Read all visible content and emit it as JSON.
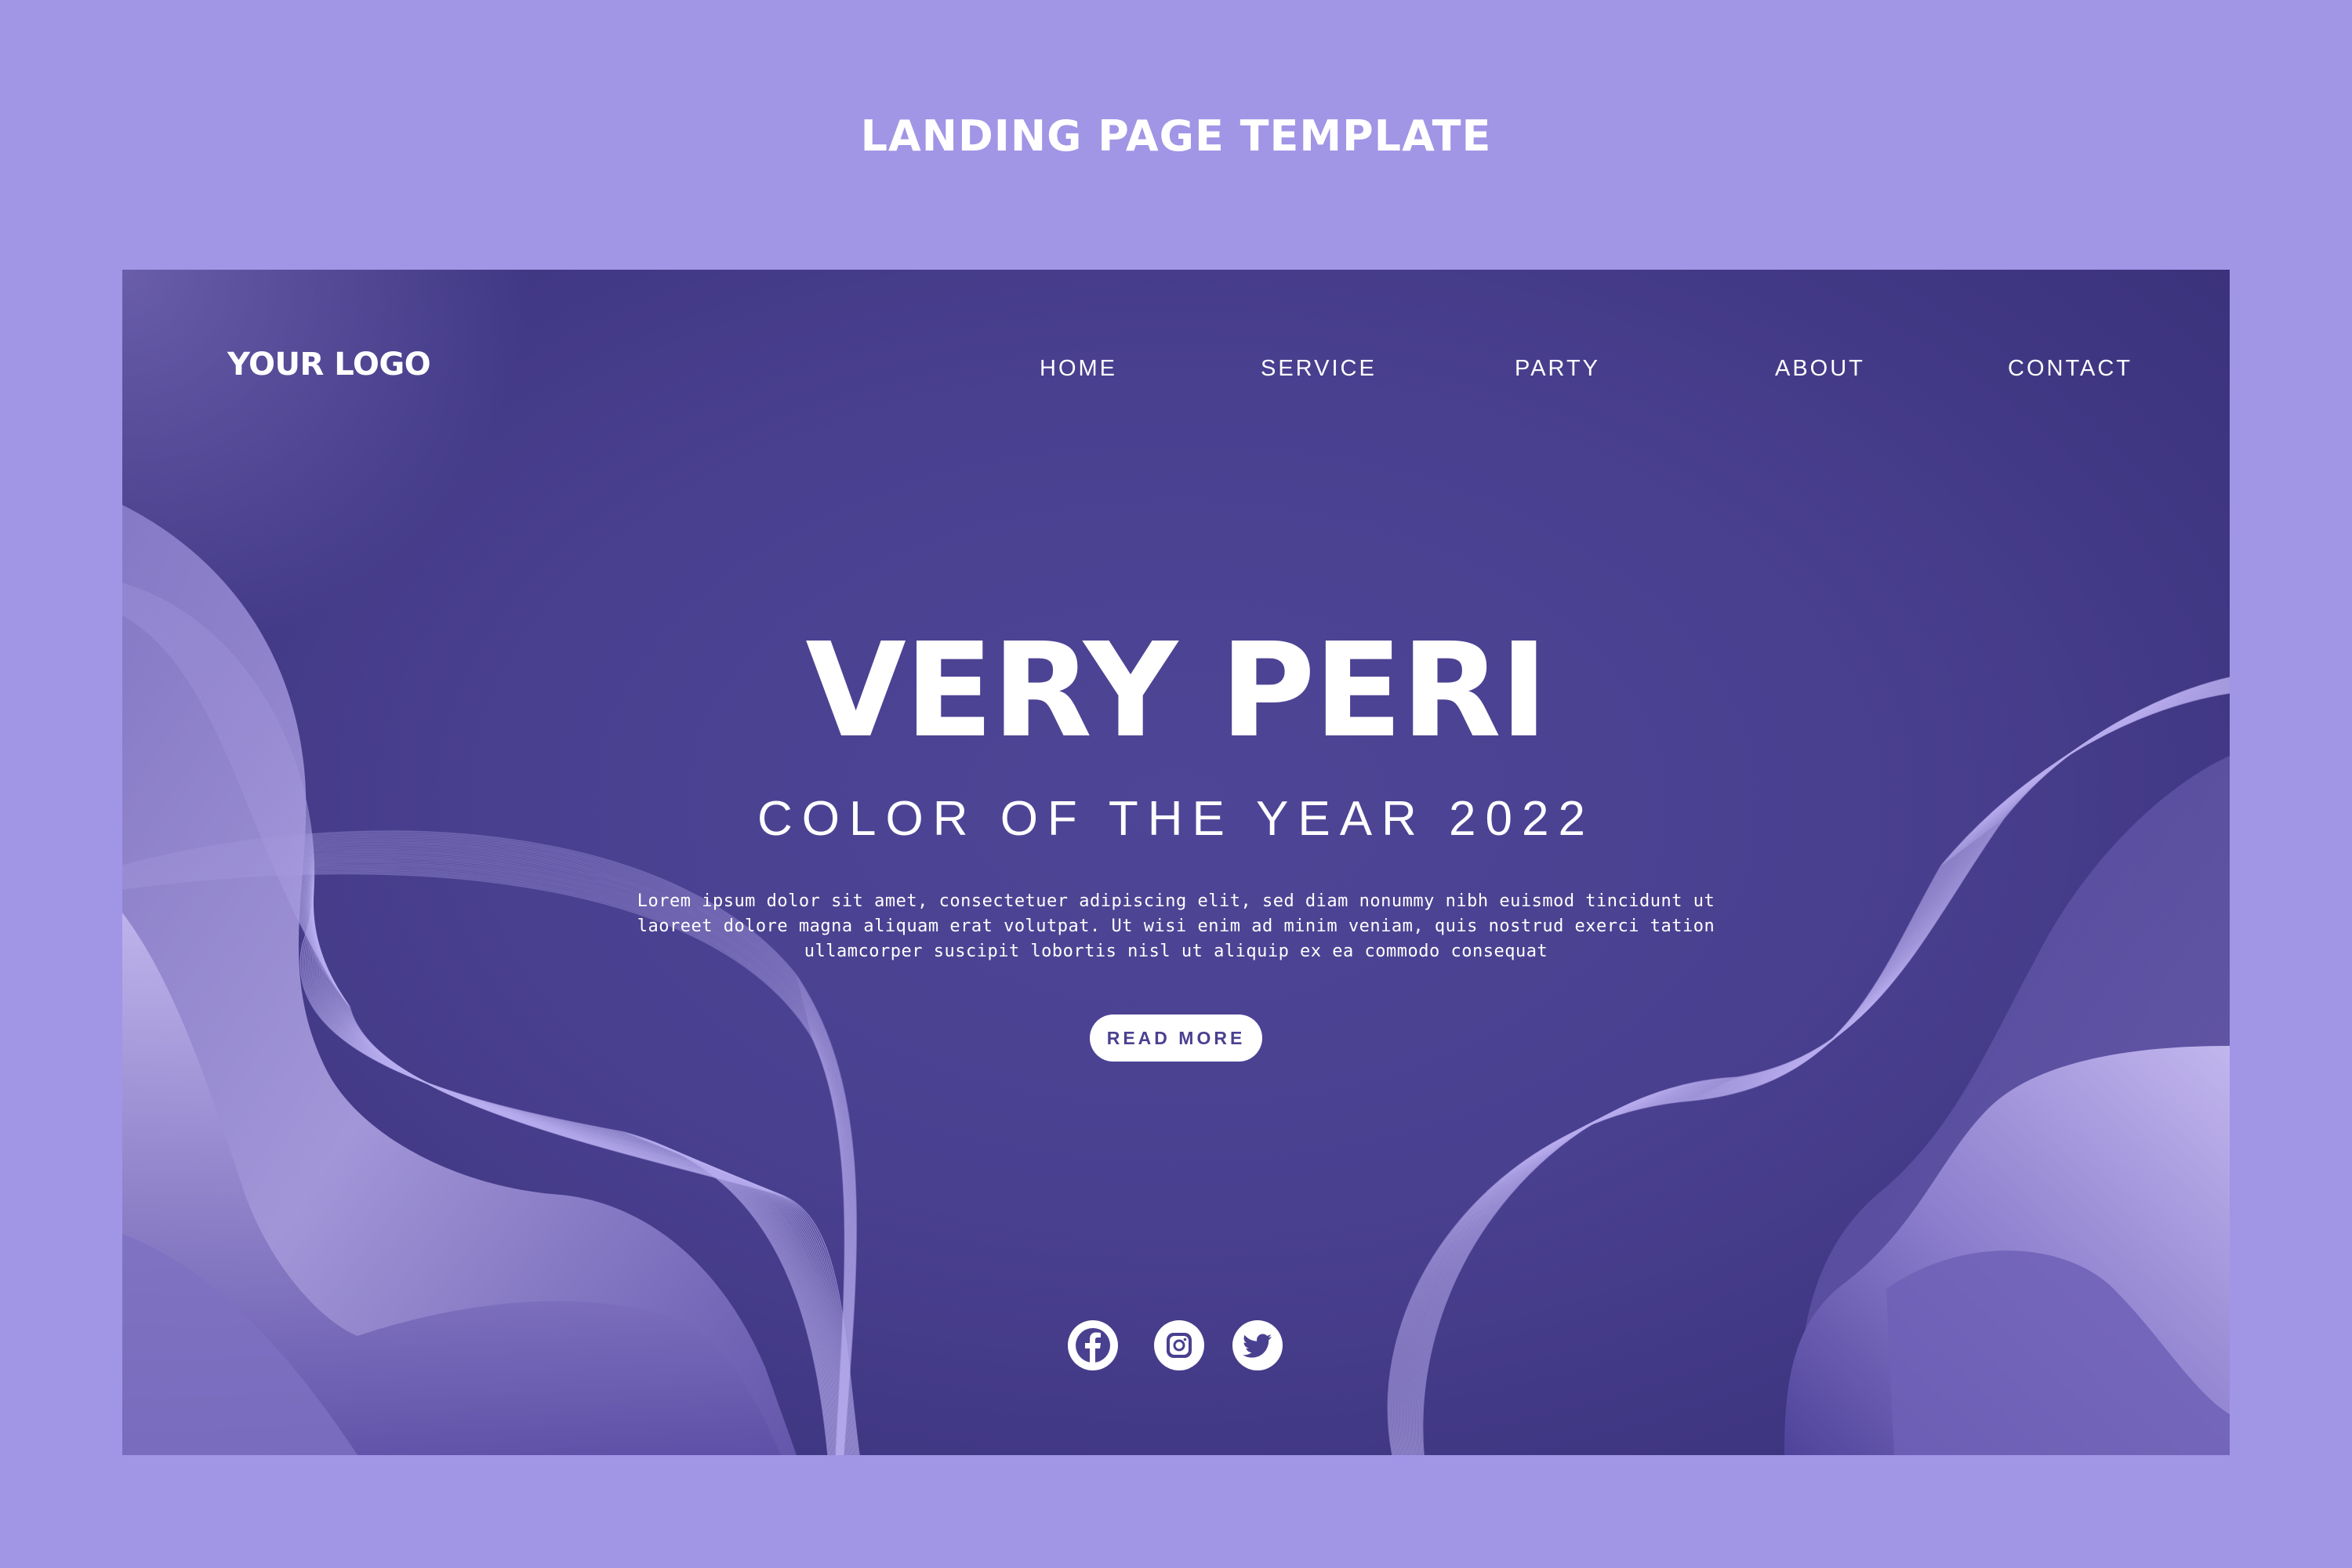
{
  "page": {
    "title": "LANDING PAGE TEMPLATE"
  },
  "header": {
    "logo": "YOUR LOGO",
    "nav": [
      {
        "label": "HOME"
      },
      {
        "label": "SERVICE"
      },
      {
        "label": "PARTY"
      },
      {
        "label": "ABOUT"
      },
      {
        "label": "CONTACT"
      }
    ]
  },
  "hero": {
    "headline": "VERY PERI",
    "subheadline": "COLOR OF THE YEAR 2022",
    "body": "Lorem ipsum dolor sit amet, consectetuer adipiscing elit, sed diam nonummy nibh euismod tincidunt ut laoreet dolore magna aliquam erat volutpat. Ut wisi enim ad minim veniam, quis nostrud exerci tation ullamcorper suscipit lobortis nisl ut aliquip ex ea commodo consequat",
    "cta_label": "READ MORE"
  },
  "social": [
    {
      "icon": "facebook-icon"
    },
    {
      "icon": "instagram-icon"
    },
    {
      "icon": "twitter-icon"
    }
  ],
  "colors": {
    "frame_background": "#a195e6",
    "hero_background": "#4a4090",
    "text": "#ffffff",
    "button_text": "#4a4090"
  }
}
